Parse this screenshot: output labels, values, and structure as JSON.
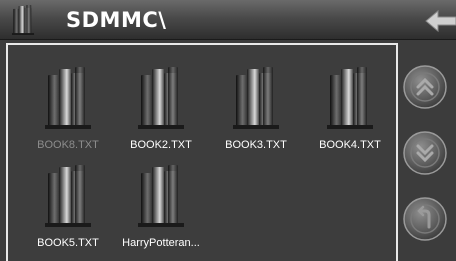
{
  "header": {
    "title": "SDMMC\\",
    "book_icon": "book-icon",
    "back_icon": "back-arrow-icon"
  },
  "files": [
    {
      "name": "BOOK8.TXT",
      "selected": true
    },
    {
      "name": "BOOK2.TXT",
      "selected": false
    },
    {
      "name": "BOOK3.TXT",
      "selected": false
    },
    {
      "name": "BOOK4.TXT",
      "selected": false
    },
    {
      "name": "BOOK5.TXT",
      "selected": false
    },
    {
      "name": "HarryPotteran...",
      "selected": false
    }
  ],
  "sidebar": {
    "buttons": [
      {
        "icon": "double-chevron-up-icon"
      },
      {
        "icon": "double-chevron-down-icon"
      },
      {
        "icon": "return-icon"
      }
    ]
  },
  "colors": {
    "background": "#3c3c3c",
    "panel_border": "#e9e9e9",
    "text": "#ffffff",
    "selected_text": "#8c8c8c"
  }
}
